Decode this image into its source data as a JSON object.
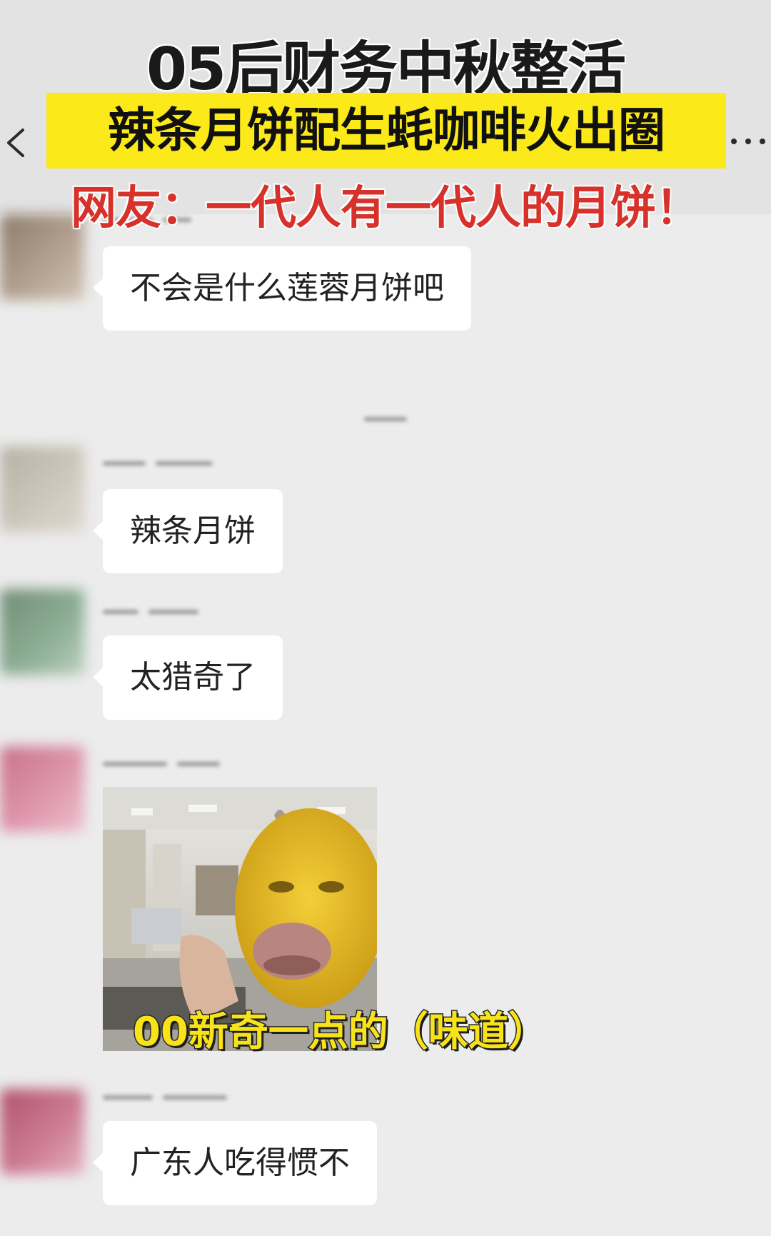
{
  "video": {
    "title": "05后财务中秋整活",
    "banner": "辣条月饼配生蚝咖啡火出圈",
    "sub_caption": "网友：一代人有一代人的月饼！",
    "bottom_caption": "00新奇一点的（味道）"
  },
  "nav": {
    "back_icon": "chevron-left-icon",
    "more_icon": "more-dots-icon",
    "more_text": "···"
  },
  "messages": [
    {
      "text": "不会是什么莲蓉月饼吧"
    },
    {
      "text": "辣条月饼"
    },
    {
      "text": "太猎奇了"
    },
    {
      "type": "sticker",
      "icon": "meme-sticker-image"
    },
    {
      "text": "广东人吃得惯不"
    }
  ],
  "colors": {
    "banner_yellow": "#fbe91a",
    "sub_caption_red": "#d6312a",
    "caption_yellow": "#f8e21a",
    "bubble_white": "#ffffff",
    "chat_background": "#ececec"
  }
}
